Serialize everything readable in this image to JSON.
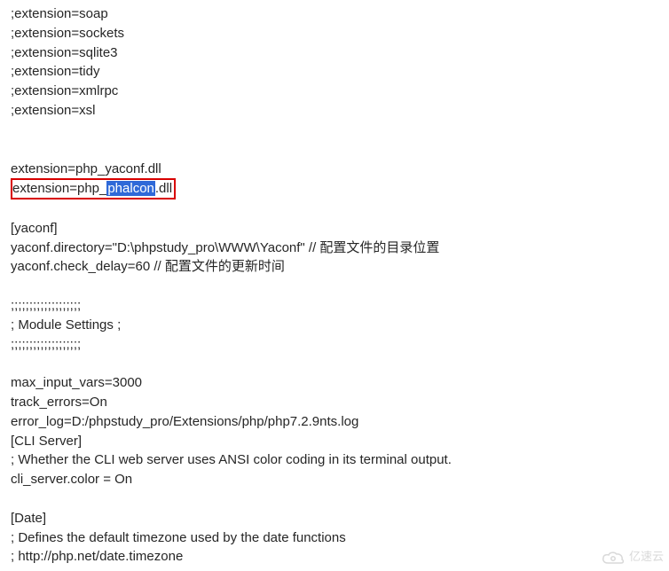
{
  "lines": {
    "l01": ";extension=soap",
    "l02": ";extension=sockets",
    "l03": ";extension=sqlite3",
    "l04": ";extension=tidy",
    "l05": ";extension=xmlrpc",
    "l06": ";extension=xsl",
    "l07": "extension=php_yaconf.dll",
    "l08_pre": "extension=php_",
    "l08_hl": "phalcon",
    "l08_post": ".dll",
    "l09": "[yaconf]",
    "l10": "yaconf.directory=\"D:\\phpstudy_pro\\WWW\\Yaconf\" // 配置文件的目录位置",
    "l11": "yaconf.check_delay=60 //  配置文件的更新时间",
    "l12": ";;;;;;;;;;;;;;;;;;;",
    "l13": "; Module Settings ;",
    "l14": ";;;;;;;;;;;;;;;;;;;",
    "l15": "max_input_vars=3000",
    "l16": "track_errors=On",
    "l17": "error_log=D:/phpstudy_pro/Extensions/php/php7.2.9nts.log",
    "l18": "[CLI Server]",
    "l19": "; Whether the CLI web server uses ANSI color coding in its terminal output.",
    "l20": "cli_server.color = On",
    "l21": "[Date]",
    "l22": "; Defines the default timezone used by the date functions",
    "l23": "; http://php.net/date.timezone"
  },
  "watermark": "亿速云"
}
